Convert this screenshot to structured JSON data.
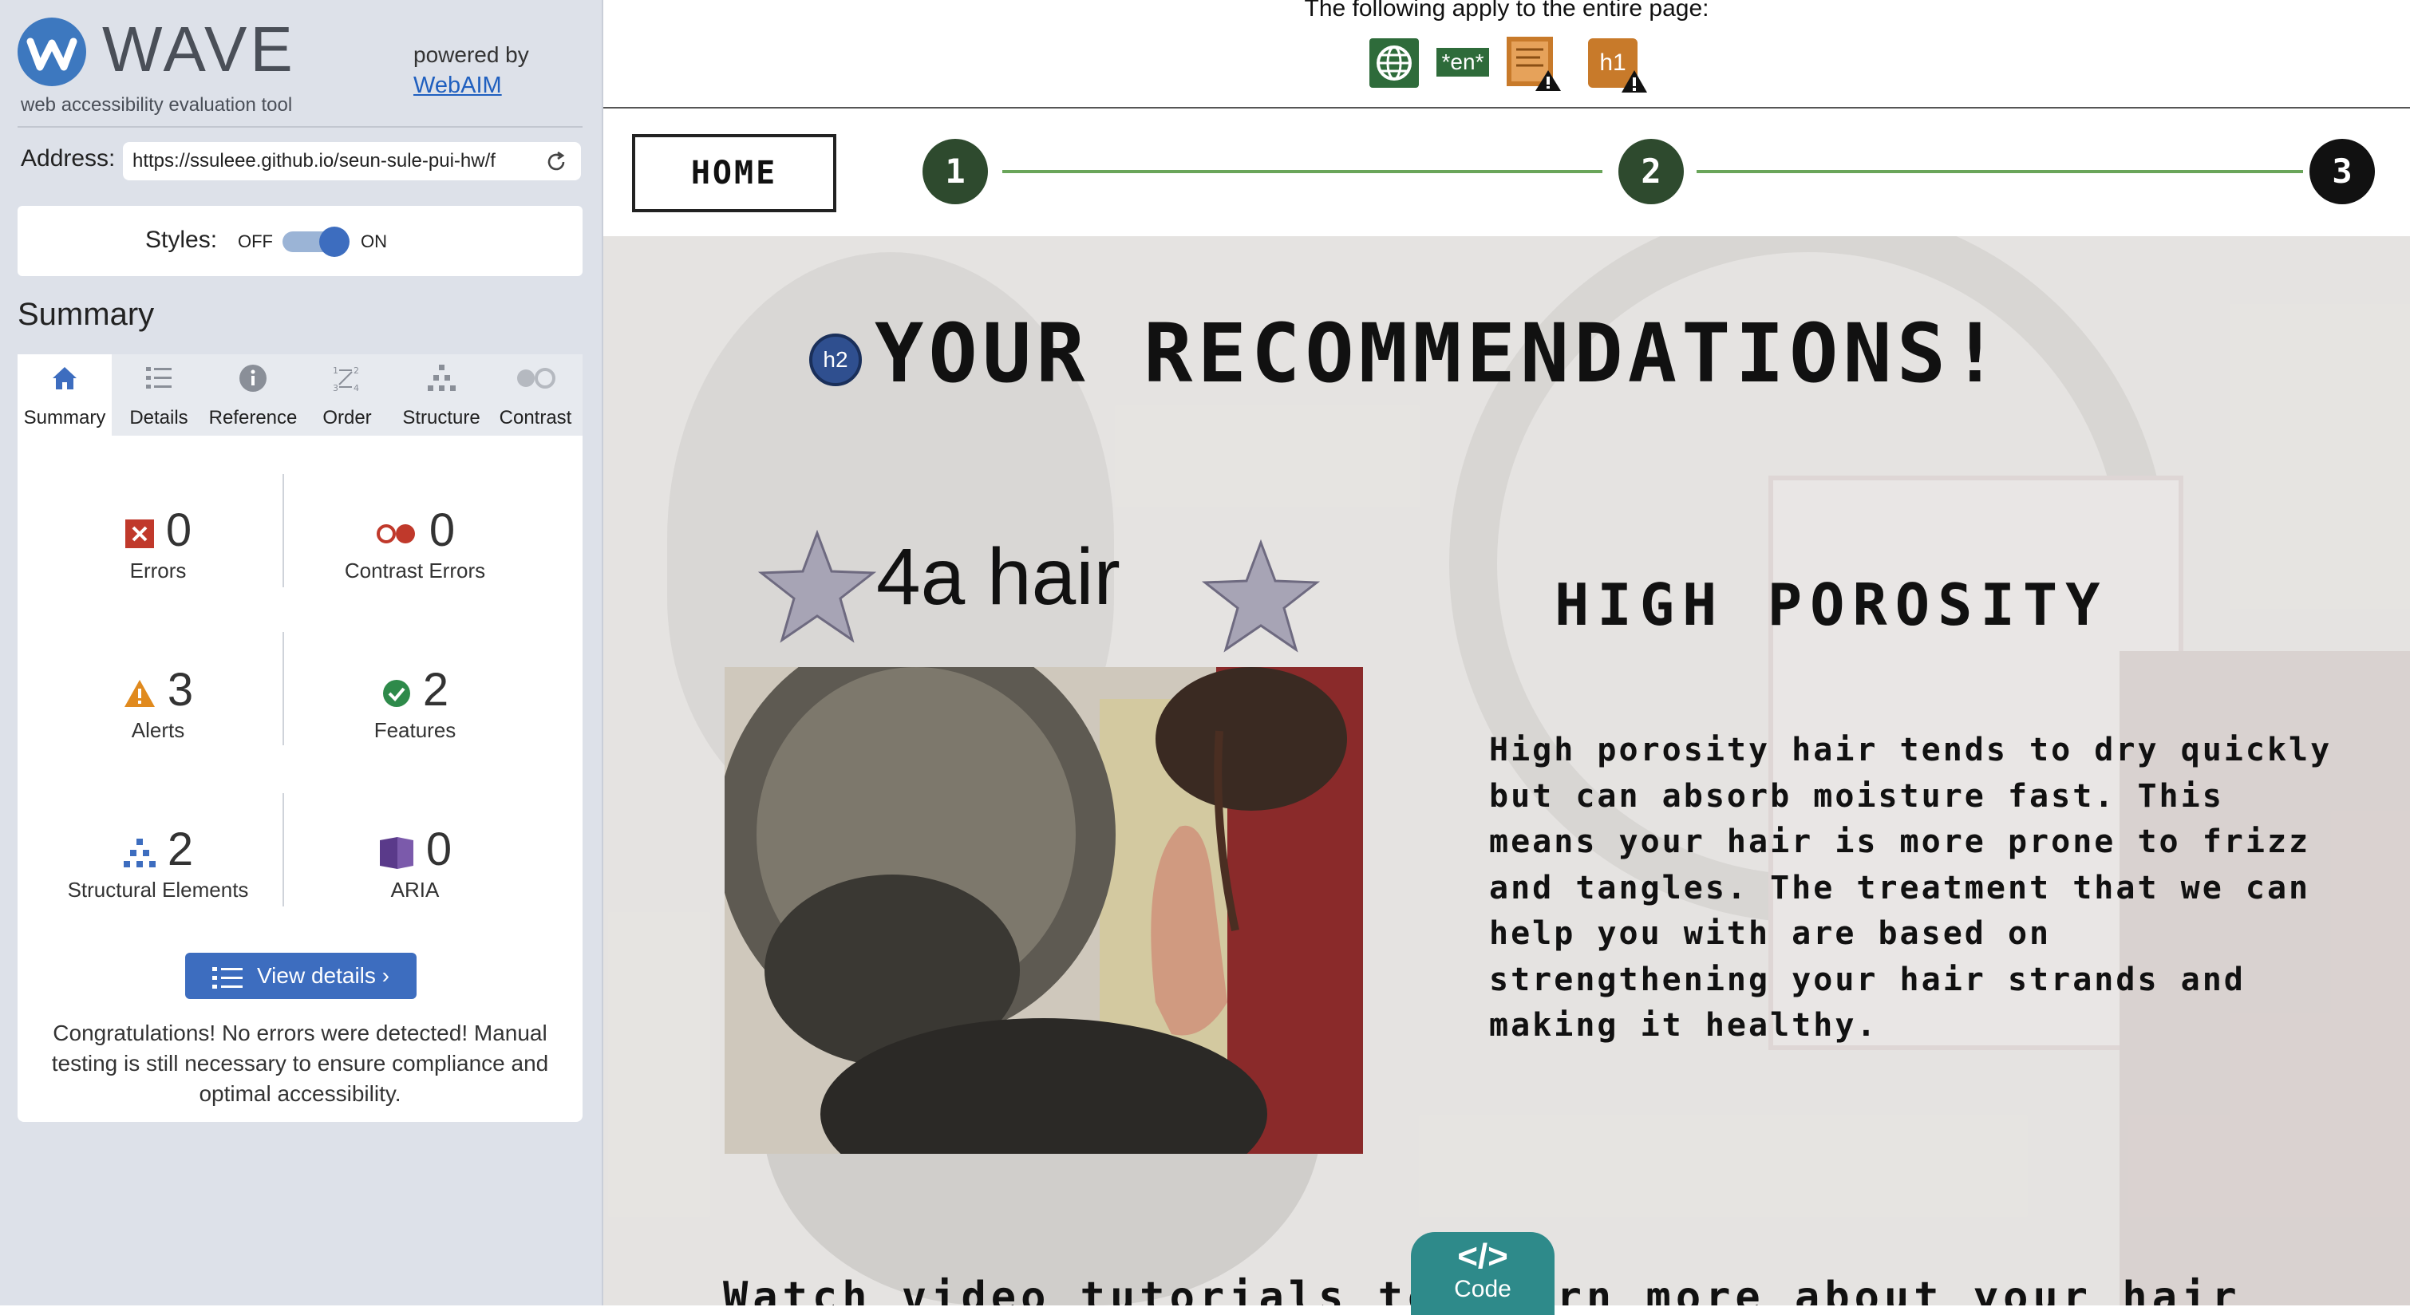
{
  "sidebar": {
    "brand": "WAVE",
    "tagline": "web accessibility evaluation tool",
    "powered_by": "powered by",
    "powered_link": "WebAIM",
    "address_label": "Address:",
    "address_value": "https://ssuleee.github.io/seun-sule-pui-hw/f",
    "styles_label": "Styles:",
    "styles_off": "OFF",
    "styles_on": "ON",
    "styles_enabled": true,
    "summary_heading": "Summary",
    "tabs": [
      {
        "label": "Summary",
        "icon": "home-icon",
        "active": true
      },
      {
        "label": "Details",
        "icon": "list-icon",
        "active": false
      },
      {
        "label": "Reference",
        "icon": "info-icon",
        "active": false
      },
      {
        "label": "Order",
        "icon": "order-icon",
        "active": false
      },
      {
        "label": "Structure",
        "icon": "structure-icon",
        "active": false
      },
      {
        "label": "Contrast",
        "icon": "contrast-icon",
        "active": false
      }
    ],
    "stats": {
      "errors": {
        "count": "0",
        "label": "Errors"
      },
      "contrast_errors": {
        "count": "0",
        "label": "Contrast Errors"
      },
      "alerts": {
        "count": "3",
        "label": "Alerts"
      },
      "features": {
        "count": "2",
        "label": "Features"
      },
      "structural": {
        "count": "2",
        "label": "Structural Elements"
      },
      "aria": {
        "count": "0",
        "label": "ARIA"
      }
    },
    "view_details": "View details ›",
    "congrats": "Congratulations! No errors were detected! Manual testing is still necessary to ensure compliance and optimal accessibility."
  },
  "topbar": {
    "text": "The following apply to the entire page:",
    "icons": [
      {
        "name": "language-globe-icon",
        "color": "#2e6b3a"
      },
      {
        "name": "lang-en-icon",
        "text": "*en*",
        "color": "#2e6b3a"
      },
      {
        "name": "page-title-alert-icon",
        "color": "#c87a2a"
      },
      {
        "name": "h1-alert-icon",
        "text": "h1",
        "color": "#c87a2a"
      }
    ]
  },
  "site": {
    "nav_home": "HOME",
    "steps": [
      "1",
      "2",
      "3"
    ],
    "h2_badge": "h2",
    "title": "YOUR RECOMMENDATIONS!",
    "hair_label": "4a hair",
    "porosity_title": "HIGH POROSITY",
    "porosity_text": "High porosity hair tends to dry quickly but can absorb moisture fast. This means your hair is more prone to frizz and tangles. The treatment that we can help you with are based on strengthening your hair strands and making it healthy.",
    "bottom_text": "Watch video tutorials to learn more about your hair",
    "code_glyph": "</>",
    "code_label": "Code"
  },
  "colors": {
    "wave_blue": "#3d6dbf",
    "step_green": "#2e4a2e",
    "step_active": "#111111",
    "progress_line": "#6aa55a",
    "error_red": "#c0392b",
    "alert_orange": "#e08a1e",
    "feature_green": "#2e8a4a",
    "aria_purple": "#5a3a8a"
  }
}
